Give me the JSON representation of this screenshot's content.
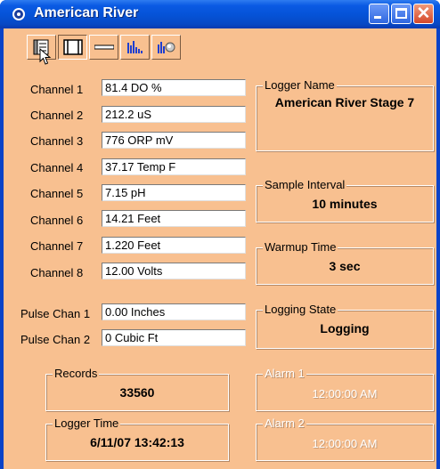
{
  "window": {
    "title": "American River"
  },
  "toolbar": {
    "buttons": [
      {
        "name": "log-view-icon"
      },
      {
        "name": "split-view-icon"
      },
      {
        "name": "line-icon"
      },
      {
        "name": "bar-graph-icon"
      },
      {
        "name": "chart-lookup-icon"
      }
    ]
  },
  "channels": [
    {
      "label": "Channel 1",
      "value": "81.4 DO %"
    },
    {
      "label": "Channel 2",
      "value": "212.2 uS"
    },
    {
      "label": "Channel 3",
      "value": "776 ORP mV"
    },
    {
      "label": "Channel 4",
      "value": "37.17 Temp F"
    },
    {
      "label": "Channel 5",
      "value": "7.15 pH"
    },
    {
      "label": "Channel 6",
      "value": "14.21 Feet"
    },
    {
      "label": "Channel 7",
      "value": "1.220 Feet"
    },
    {
      "label": "Channel 8",
      "value": "12.00 Volts"
    }
  ],
  "pulse": [
    {
      "label": "Pulse Chan 1",
      "value": "0.00 Inches"
    },
    {
      "label": "Pulse Chan 2",
      "value": "0 Cubic Ft"
    }
  ],
  "groups": {
    "logger_name": {
      "title": "Logger Name",
      "value": "American River Stage 7"
    },
    "sample_interval": {
      "title": "Sample Interval",
      "value": "10 minutes"
    },
    "warmup_time": {
      "title": "Warmup Time",
      "value": "3 sec"
    },
    "logging_state": {
      "title": "Logging State",
      "value": "Logging"
    },
    "records": {
      "title": "Records",
      "value": "33560"
    },
    "alarm1": {
      "title": "Alarm 1",
      "value": "12:00:00 AM"
    },
    "logger_time": {
      "title": "Logger Time",
      "value": "6/11/07 13:42:13"
    },
    "alarm2": {
      "title": "Alarm 2",
      "value": "12:00:00 AM"
    }
  },
  "colors": {
    "background": "#f8c090",
    "titlebar": "#0552d6",
    "chart_blue": "#1f3fd0"
  }
}
